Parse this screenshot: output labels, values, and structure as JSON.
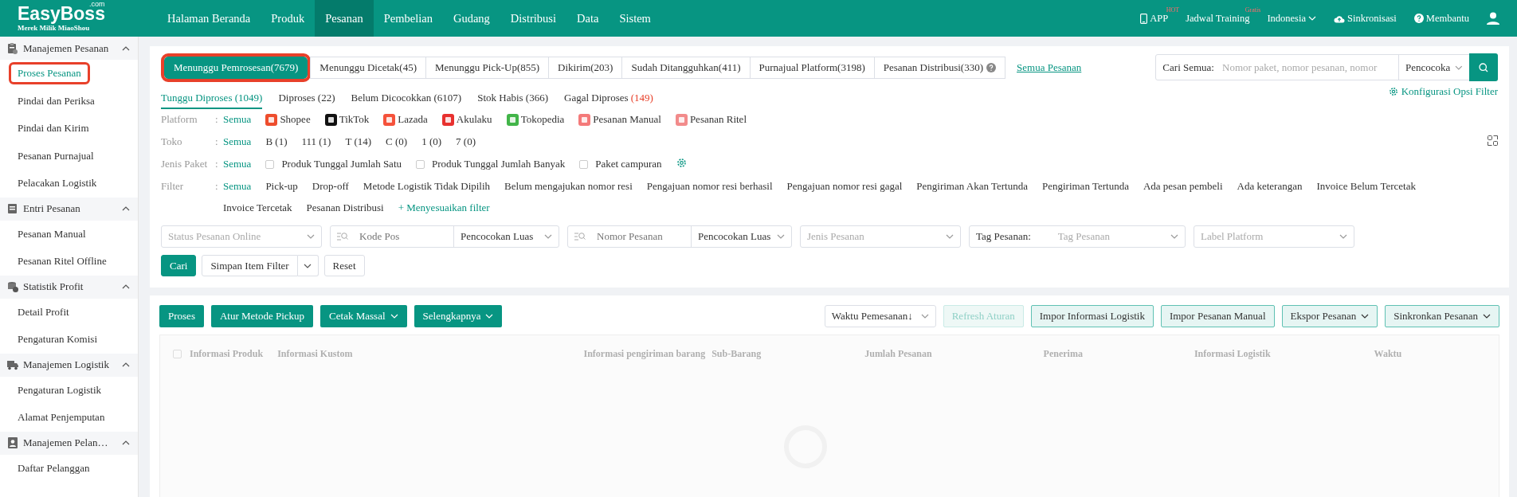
{
  "header": {
    "logo": "EasyBoss",
    "logo_sup": ".com",
    "tagline": "Merek Milik MiaoShou",
    "nav": [
      {
        "label": "Halaman Beranda",
        "selected": false
      },
      {
        "label": "Produk",
        "selected": false
      },
      {
        "label": "Pesanan",
        "selected": true
      },
      {
        "label": "Pembelian",
        "selected": false
      },
      {
        "label": "Gudang",
        "selected": false
      },
      {
        "label": "Distribusi",
        "selected": false
      },
      {
        "label": "Data",
        "selected": false
      },
      {
        "label": "Sistem",
        "selected": false
      }
    ],
    "tools": [
      {
        "kind": "app",
        "label": "APP",
        "badge": "HOT"
      },
      {
        "kind": "training",
        "label": "Jadwal Training",
        "badge": "Gratis"
      },
      {
        "kind": "language",
        "label": "Indonesia"
      },
      {
        "kind": "sync",
        "label": "Sinkronisasi"
      },
      {
        "kind": "help",
        "label": "Membantu"
      },
      {
        "kind": "user"
      }
    ]
  },
  "sidebar": {
    "groups": [
      {
        "title": "Manajemen Pesanan",
        "expanded": true,
        "items": [
          {
            "label": "Proses Pesanan",
            "selected": true,
            "highlighted": true
          },
          {
            "label": "Pindai dan Periksa",
            "selected": false,
            "highlighted": false
          },
          {
            "label": "Pindai dan Kirim",
            "selected": false,
            "highlighted": false
          },
          {
            "label": "Pesanan Purnajual",
            "selected": false,
            "highlighted": false
          },
          {
            "label": "Pelacakan Logistik",
            "selected": false,
            "highlighted": false
          }
        ]
      },
      {
        "title": "Entri Pesanan",
        "expanded": true,
        "items": [
          {
            "label": "Pesanan Manual",
            "selected": false,
            "highlighted": false
          },
          {
            "label": "Pesanan Ritel Offline",
            "selected": false,
            "highlighted": false
          }
        ]
      },
      {
        "title": "Statistik Profit",
        "expanded": true,
        "items": [
          {
            "label": "Detail Profit",
            "selected": false,
            "highlighted": false
          },
          {
            "label": "Pengaturan Komisi",
            "selected": false,
            "highlighted": false
          }
        ]
      },
      {
        "title": "Manajemen Logistik",
        "expanded": true,
        "items": [
          {
            "label": "Pengaturan Logistik",
            "selected": false,
            "highlighted": false
          },
          {
            "label": "Alamat Penjemputan",
            "selected": false,
            "highlighted": false
          }
        ]
      },
      {
        "title": "Manajemen Pelan…",
        "expanded": true,
        "items": [
          {
            "label": "Daftar Pelanggan",
            "selected": false,
            "highlighted": false
          }
        ]
      }
    ]
  },
  "status_tabs": [
    {
      "label": "Menunggu Pemrosesan(7679)",
      "selected": true,
      "highlighted": true,
      "help": false
    },
    {
      "label": "Menunggu Dicetak(45)",
      "selected": false,
      "highlighted": false,
      "help": false
    },
    {
      "label": "Menunggu Pick-Up(855)",
      "selected": false,
      "highlighted": false,
      "help": false
    },
    {
      "label": "Dikirim(203)",
      "selected": false,
      "highlighted": false,
      "help": false
    },
    {
      "label": "Sudah Ditangguhkan(411)",
      "selected": false,
      "highlighted": false,
      "help": false
    },
    {
      "label": "Purnajual Platform(3198)",
      "selected": false,
      "highlighted": false,
      "help": false
    },
    {
      "label": "Pesanan Distribusi(330)",
      "selected": false,
      "highlighted": false,
      "help": true
    }
  ],
  "all_orders_link": "Semua Pesanan",
  "search": {
    "label": "Cari Semua:",
    "placeholder": "Nomor paket, nomor pesanan, nomor",
    "match": "Pencocoka"
  },
  "config_link": "Konfigurasi Opsi Filter",
  "sub_tabs": [
    {
      "label": "Tunggu Diproses",
      "count": "(1049)",
      "alert": false,
      "selected": true
    },
    {
      "label": "Diproses",
      "count": "(22)",
      "alert": false,
      "selected": false
    },
    {
      "label": "Belum Dicocokkan",
      "count": "(6107)",
      "alert": false,
      "selected": false
    },
    {
      "label": "Stok Habis",
      "count": "(366)",
      "alert": false,
      "selected": false
    },
    {
      "label": "Gagal Diproses",
      "count": "(149)",
      "alert": true,
      "selected": false
    }
  ],
  "filter_rows": [
    {
      "label": "Platform",
      "separator": ":",
      "options": [
        {
          "kind": "text",
          "label": "Semua",
          "selected": true
        },
        {
          "kind": "platform",
          "label": "Shopee",
          "color": "#ee4d2d",
          "selected": false
        },
        {
          "kind": "platform",
          "label": "TikTok",
          "color": "#111111",
          "selected": false
        },
        {
          "kind": "platform",
          "label": "Lazada",
          "color": "#f5523b",
          "selected": false
        },
        {
          "kind": "platform",
          "label": "Akulaku",
          "color": "#e8312f",
          "selected": false
        },
        {
          "kind": "platform",
          "label": "Tokopedia",
          "color": "#42b549",
          "selected": false
        },
        {
          "kind": "platform",
          "label": "Pesanan Manual",
          "color": "#f47a7a",
          "selected": false
        },
        {
          "kind": "platform",
          "label": "Pesanan Ritel",
          "color": "#f28b8b",
          "selected": false
        }
      ]
    },
    {
      "label": "Toko",
      "separator": ":",
      "options": [
        {
          "kind": "text",
          "label": "Semua",
          "selected": true
        },
        {
          "kind": "text",
          "label": "B (1)",
          "selected": false
        },
        {
          "kind": "text",
          "label": "111 (1)",
          "selected": false
        },
        {
          "kind": "text",
          "label": "T (14)",
          "selected": false
        },
        {
          "kind": "text",
          "label": "C (0)",
          "selected": false
        },
        {
          "kind": "text",
          "label": "1 (0)",
          "selected": false
        },
        {
          "kind": "text",
          "label": "7 (0)",
          "selected": false
        }
      ]
    },
    {
      "label": "Jenis Paket",
      "separator": ":",
      "options": [
        {
          "kind": "text",
          "label": "Semua",
          "selected": true
        },
        {
          "kind": "checkbox",
          "label": "Produk Tunggal Jumlah Satu",
          "selected": false
        },
        {
          "kind": "checkbox",
          "label": "Produk Tunggal Jumlah Banyak",
          "selected": false
        },
        {
          "kind": "checkbox",
          "label": "Paket campuran",
          "selected": false
        },
        {
          "kind": "gear"
        }
      ]
    },
    {
      "label": "Filter",
      "separator": ":",
      "options": [
        {
          "kind": "text",
          "label": "Semua",
          "selected": true
        },
        {
          "kind": "text",
          "label": "Pick-up",
          "selected": false
        },
        {
          "kind": "text",
          "label": "Drop-off",
          "selected": false
        },
        {
          "kind": "text",
          "label": "Metode Logistik Tidak Dipilih",
          "selected": false
        },
        {
          "kind": "text",
          "label": "Belum mengajukan nomor resi",
          "selected": false
        },
        {
          "kind": "text",
          "label": "Pengajuan nomor resi berhasil",
          "selected": false
        },
        {
          "kind": "text",
          "label": "Pengajuan nomor resi gagal",
          "selected": false
        },
        {
          "kind": "text",
          "label": "Pengiriman Akan Tertunda",
          "selected": false
        },
        {
          "kind": "text",
          "label": "Pengiriman Tertunda",
          "selected": false
        },
        {
          "kind": "text",
          "label": "Ada pesan pembeli",
          "selected": false
        },
        {
          "kind": "text",
          "label": "Ada keterangan",
          "selected": false
        },
        {
          "kind": "text",
          "label": "Invoice Belum Tercetak",
          "selected": false
        },
        {
          "kind": "text",
          "label": "Invoice Tercetak",
          "selected": false
        },
        {
          "kind": "text",
          "label": "Pesanan Distribusi",
          "selected": false
        },
        {
          "kind": "add",
          "label": "+ Menyesuaikan filter"
        }
      ]
    }
  ],
  "fields": [
    {
      "kind": "select",
      "placeholder": "Status Pesanan Online"
    },
    {
      "kind": "search_match",
      "placeholder": "Kode Pos",
      "match": "Pencocokan Luas"
    },
    {
      "kind": "search_match",
      "placeholder": "Nomor Pesanan",
      "match": "Pencocokan Luas"
    },
    {
      "kind": "select",
      "placeholder": "Jenis Pesanan"
    },
    {
      "kind": "labeled",
      "label": "Tag Pesanan:",
      "placeholder": "Tag Pesanan"
    },
    {
      "kind": "select",
      "placeholder": "Label Platform"
    }
  ],
  "filter_buttons": [
    {
      "kind": "primary",
      "label": "Cari"
    },
    {
      "kind": "split",
      "label": "Simpan Item Filter"
    },
    {
      "kind": "plain",
      "label": "Reset"
    }
  ],
  "actions": [
    {
      "label": "Proses",
      "dropdown": false
    },
    {
      "label": "Atur Metode Pickup",
      "dropdown": false
    },
    {
      "label": "Cetak Massal",
      "dropdown": true
    },
    {
      "label": "Selengkapnya",
      "dropdown": true
    }
  ],
  "sort": "Waktu Pemesanan↓",
  "secondary_actions": [
    {
      "label": "Refresh Aturan",
      "disabled": true,
      "dropdown": false
    },
    {
      "label": "Impor Informasi Logistik",
      "disabled": false,
      "dropdown": false
    },
    {
      "label": "Impor Pesanan Manual",
      "disabled": false,
      "dropdown": false
    },
    {
      "label": "Ekspor Pesanan",
      "disabled": false,
      "dropdown": true
    },
    {
      "label": "Sinkronkan Pesanan",
      "disabled": false,
      "dropdown": true
    }
  ],
  "table": {
    "select_all_checked": false,
    "columns": [
      "Informasi Produk",
      "Informasi Kustom",
      "Informasi pengiriman barang",
      "Sub-Barang",
      "Jumlah Pesanan",
      "Penerima",
      "Informasi Logistik",
      "Waktu"
    ]
  }
}
